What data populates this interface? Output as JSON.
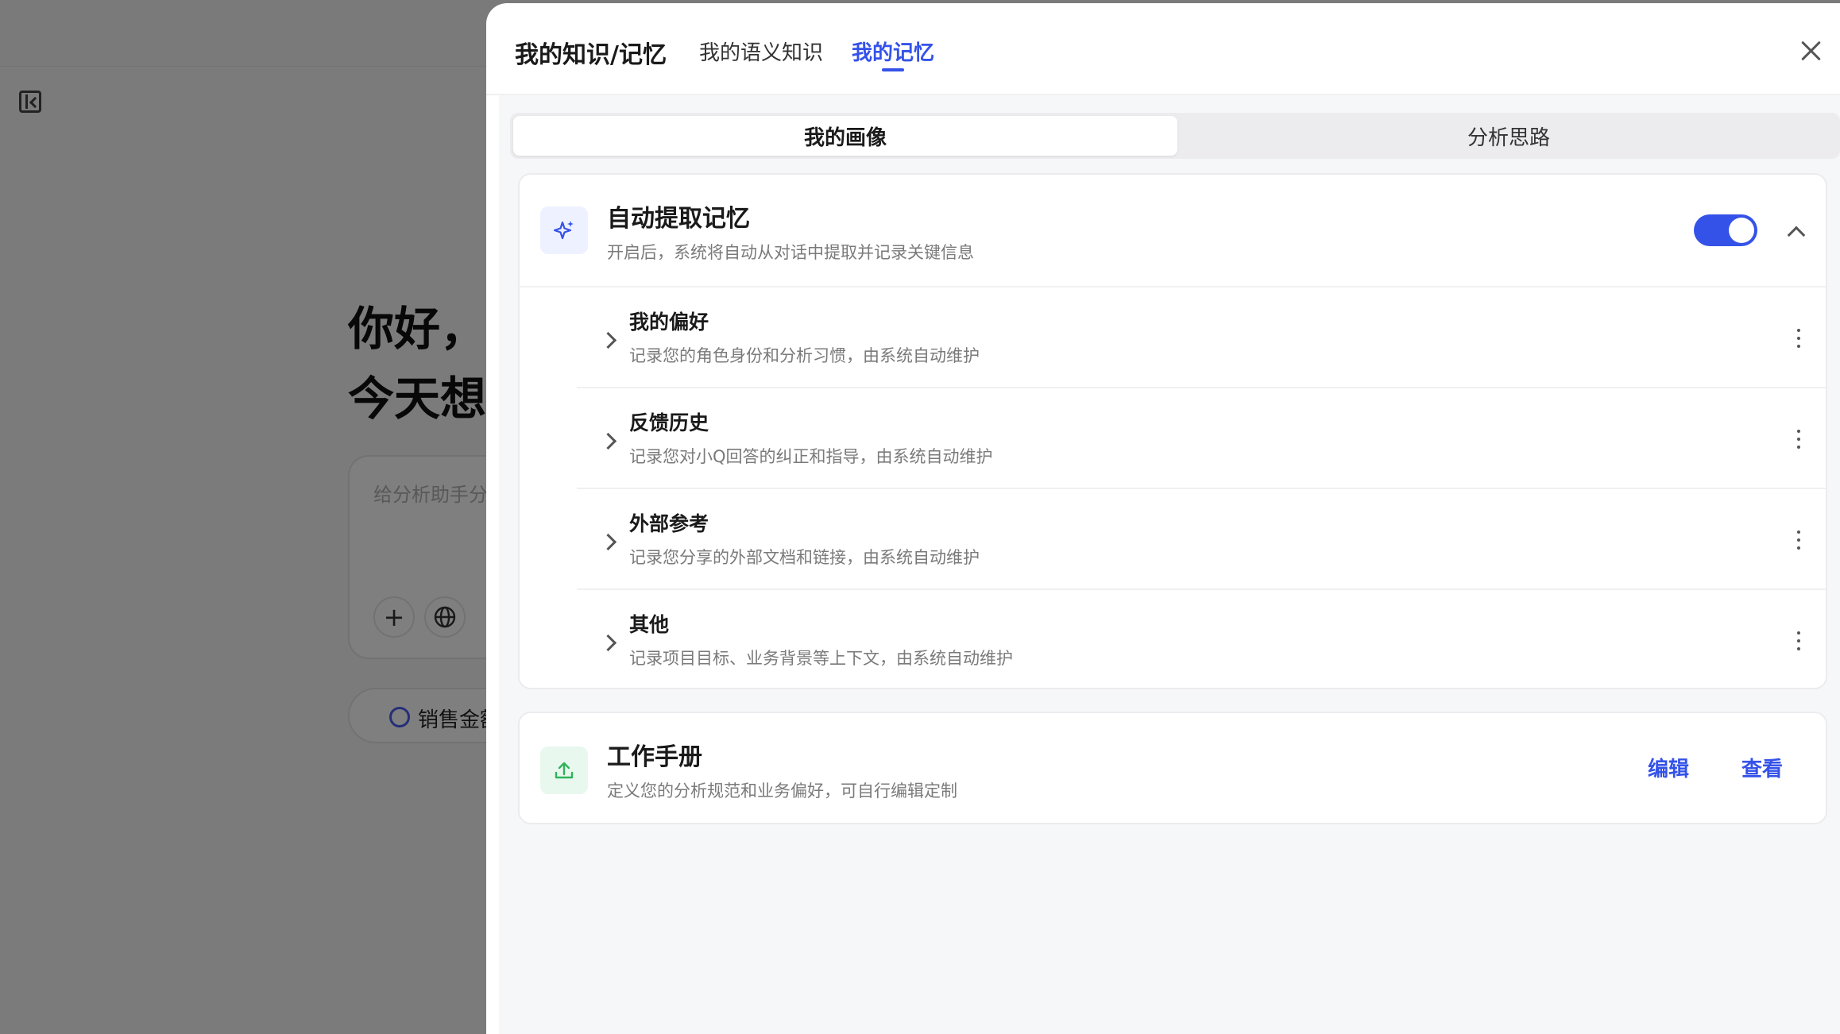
{
  "background": {
    "greeting_line1": "你好，",
    "greeting_line2": "今天想",
    "input_placeholder": "给分析助手分",
    "chip_label": "销售金额"
  },
  "drawer": {
    "title": "我的知识/记忆",
    "tabs": [
      {
        "label": "我的语义知识",
        "active": false
      },
      {
        "label": "我的记忆",
        "active": true
      }
    ],
    "segments": [
      {
        "label": "我的画像",
        "active": true
      },
      {
        "label": "分析思路",
        "active": false
      }
    ],
    "auto_memory": {
      "title": "自动提取记忆",
      "subtitle": "开启后，系统将自动从对话中提取并记录关键信息",
      "enabled": true,
      "icon": "sparkle-icon",
      "items": [
        {
          "title": "我的偏好",
          "desc": "记录您的角色身份和分析习惯，由系统自动维护"
        },
        {
          "title": "反馈历史",
          "desc": "记录您对小Q回答的纠正和指导，由系统自动维护"
        },
        {
          "title": "外部参考",
          "desc": "记录您分享的外部文档和链接，由系统自动维护"
        },
        {
          "title": "其他",
          "desc": "记录项目目标、业务背景等上下文，由系统自动维护"
        }
      ]
    },
    "handbook": {
      "title": "工作手册",
      "subtitle": "定义您的分析规范和业务偏好，可自行编辑定制",
      "icon": "upload-icon",
      "edit_label": "编辑",
      "view_label": "查看"
    }
  },
  "colors": {
    "accent": "#3452e8",
    "overlay": "rgba(0,0,0,0.5)",
    "handbook_icon": "#2fb45a"
  }
}
